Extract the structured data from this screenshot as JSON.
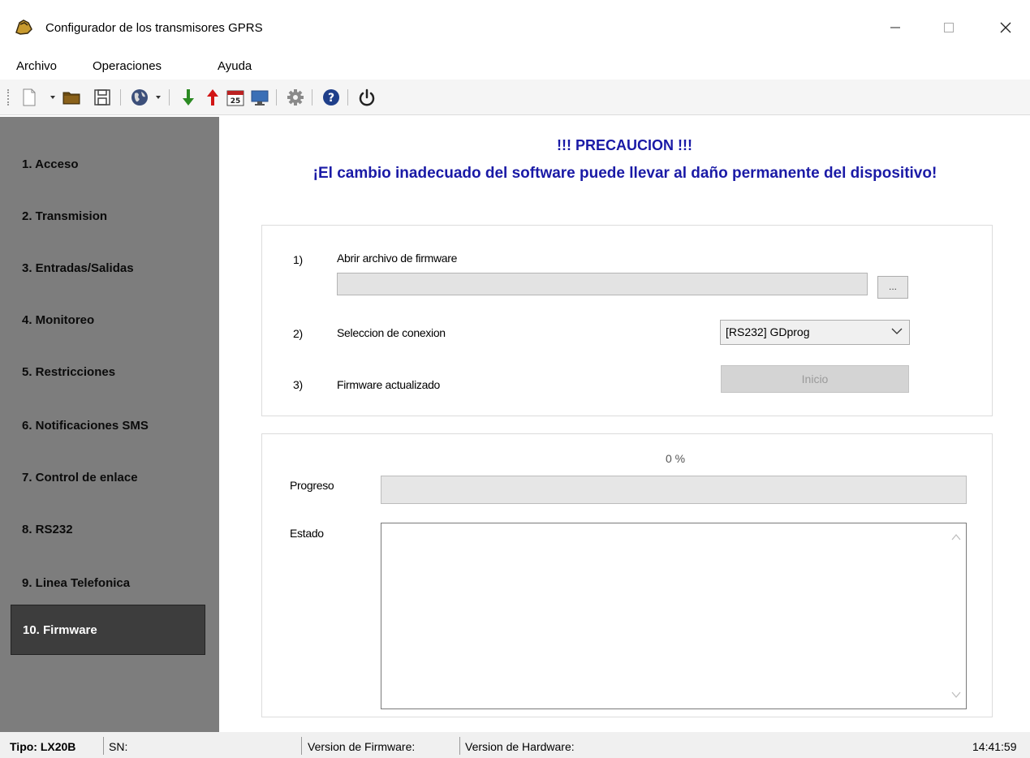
{
  "window": {
    "title": "Configurador de los transmisores GPRS",
    "minimize_glyph": "—",
    "maximize_glyph": "☐",
    "close_glyph": "✕"
  },
  "menu": {
    "items": [
      "Archivo",
      "Operaciones",
      "Ayuda"
    ]
  },
  "toolbar": {
    "icons": [
      "new-file-icon",
      "open-folder-icon",
      "save-icon",
      "globe-icon",
      "download-arrow-icon",
      "upload-arrow-icon",
      "calendar-icon",
      "monitor-icon",
      "gear-icon",
      "help-icon",
      "power-icon"
    ],
    "calendar_day": "25"
  },
  "sidebar": {
    "items": [
      {
        "label": "1. Acceso"
      },
      {
        "label": "2. Transmision"
      },
      {
        "label": "3. Entradas/Salidas"
      },
      {
        "label": "4. Monitoreo"
      },
      {
        "label": "5. Restricciones"
      },
      {
        "label": "6. Notificaciones SMS"
      },
      {
        "label": "7. Control de enlace"
      },
      {
        "label": "8. RS232"
      },
      {
        "label": "9. Linea Telefonica"
      },
      {
        "label": "10. Firmware"
      }
    ],
    "active_index": 9
  },
  "main": {
    "warning_title": "!!! PRECAUCION !!!",
    "warning_text": "¡El cambio inadecuado del software puede llevar al daño permanente del dispositivo!",
    "steps": {
      "step1_num": "1)",
      "step1_label": "Abrir archivo de firmware",
      "file_path": "",
      "browse_label": "...",
      "step2_num": "2)",
      "step2_label": "Seleccion de conexion",
      "connection_value": "[RS232] GDprog",
      "step3_num": "3)",
      "step3_label": "Firmware actualizado",
      "start_label": "Inicio"
    },
    "progress": {
      "percent_text": "0 %",
      "value": 0,
      "progress_label": "Progreso",
      "status_label": "Estado",
      "status_text": ""
    }
  },
  "statusbar": {
    "tipo": "Tipo: LX20B",
    "sn": "SN:",
    "firmware_version": "Version de Firmware:",
    "hardware_version": "Version de Hardware:",
    "time": "14:41:59"
  },
  "colors": {
    "sidebar_bg": "#7d7d7d",
    "sidebar_active": "#3d3d3d",
    "warning": "#1a1aa6"
  }
}
